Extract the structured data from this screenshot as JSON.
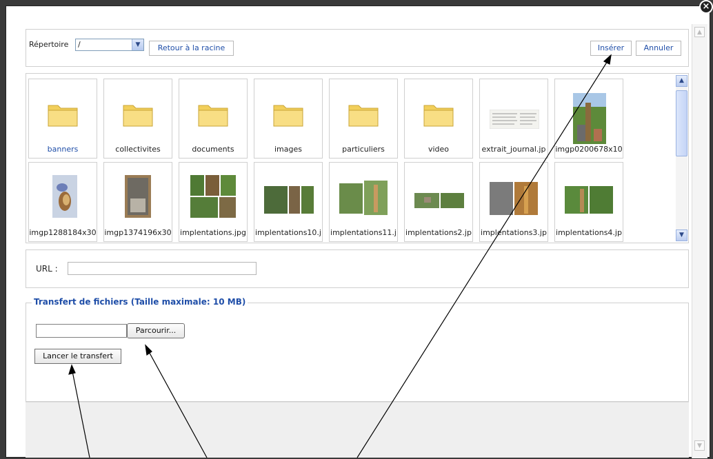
{
  "toolbar": {
    "directory_label": "Répertoire",
    "directory_value": "/",
    "root_button": "Retour à la racine",
    "insert_button": "Insérer",
    "cancel_button": "Annuler"
  },
  "files": [
    {
      "name": "banners",
      "type": "folder",
      "selected": true
    },
    {
      "name": "collectivites",
      "type": "folder"
    },
    {
      "name": "documents",
      "type": "folder"
    },
    {
      "name": "images",
      "type": "folder"
    },
    {
      "name": "particuliers",
      "type": "folder"
    },
    {
      "name": "video",
      "type": "folder"
    },
    {
      "name": "extrait_journal.jp",
      "type": "image"
    },
    {
      "name": "imgp0200678x10",
      "type": "image"
    },
    {
      "name": "imgp1288184x30",
      "type": "image"
    },
    {
      "name": "imgp1374196x30",
      "type": "image"
    },
    {
      "name": "implentations.jpg",
      "type": "image"
    },
    {
      "name": "implentations10.j",
      "type": "image"
    },
    {
      "name": "implentations11.j",
      "type": "image"
    },
    {
      "name": "implentations2.jp",
      "type": "image"
    },
    {
      "name": "implentations3.jp",
      "type": "image"
    },
    {
      "name": "implentations4.jp",
      "type": "image"
    }
  ],
  "url": {
    "label": "URL :",
    "value": ""
  },
  "transfer": {
    "legend": "Transfert de fichiers (Taille maximale: 10 MB)",
    "browse_button": "Parcourir...",
    "upload_button": "Lancer le transfert"
  },
  "colors": {
    "link": "#1f4ea8",
    "folder": "#f5d66b",
    "frame": "#222222"
  }
}
